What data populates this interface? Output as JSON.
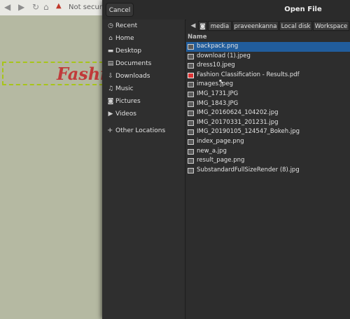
{
  "browser": {
    "security_label": "Not secure",
    "warning_icon": "warning-triangle-icon",
    "banner_text": "Fashi"
  },
  "dialog": {
    "title": "Open File",
    "cancel_label": "Cancel"
  },
  "sidebar": {
    "items": [
      {
        "label": "Recent",
        "icon": "clock-icon",
        "glyph": "◷"
      },
      {
        "label": "Home",
        "icon": "home-icon",
        "glyph": "⌂"
      },
      {
        "label": "Desktop",
        "icon": "folder-icon",
        "glyph": "▬"
      },
      {
        "label": "Documents",
        "icon": "document-icon",
        "glyph": "▤"
      },
      {
        "label": "Downloads",
        "icon": "download-icon",
        "glyph": "⇩"
      },
      {
        "label": "Music",
        "icon": "music-icon",
        "glyph": "♫"
      },
      {
        "label": "Pictures",
        "icon": "camera-icon",
        "glyph": "◙"
      },
      {
        "label": "Videos",
        "icon": "video-icon",
        "glyph": "▶"
      }
    ],
    "other_locations": {
      "label": "Other Locations",
      "icon": "plus-icon",
      "glyph": "+"
    }
  },
  "pathbar": {
    "segments": [
      "media",
      "praveenkanna",
      "Local disk",
      "Workspace"
    ]
  },
  "filelist": {
    "column_header": "Name",
    "files": [
      {
        "name": "backpack.png",
        "selected": true
      },
      {
        "name": "download (1).jpeg",
        "selected": false
      },
      {
        "name": "dress10.jpeg",
        "selected": false
      },
      {
        "name": "Fashion Classification - Results.pdf",
        "selected": false
      },
      {
        "name": "images.jpeg",
        "selected": false
      },
      {
        "name": "IMG_1731.JPG",
        "selected": false
      },
      {
        "name": "IMG_1843.JPG",
        "selected": false
      },
      {
        "name": "IMG_20160624_104202.jpg",
        "selected": false
      },
      {
        "name": "IMG_20170331_201231.jpg",
        "selected": false
      },
      {
        "name": "IMG_20190105_124547_Bokeh.jpg",
        "selected": false
      },
      {
        "name": "index_page.png",
        "selected": false
      },
      {
        "name": "new_a.jpg",
        "selected": false
      },
      {
        "name": "result_page.png",
        "selected": false
      },
      {
        "name": "SubstandardFullSizeRender (8).jpg",
        "selected": false
      }
    ]
  },
  "colors": {
    "selection": "#215d9c",
    "dialog_bg": "#2b2b2b",
    "page_bg": "#b5b9a2",
    "banner_text": "#c13a3a"
  }
}
